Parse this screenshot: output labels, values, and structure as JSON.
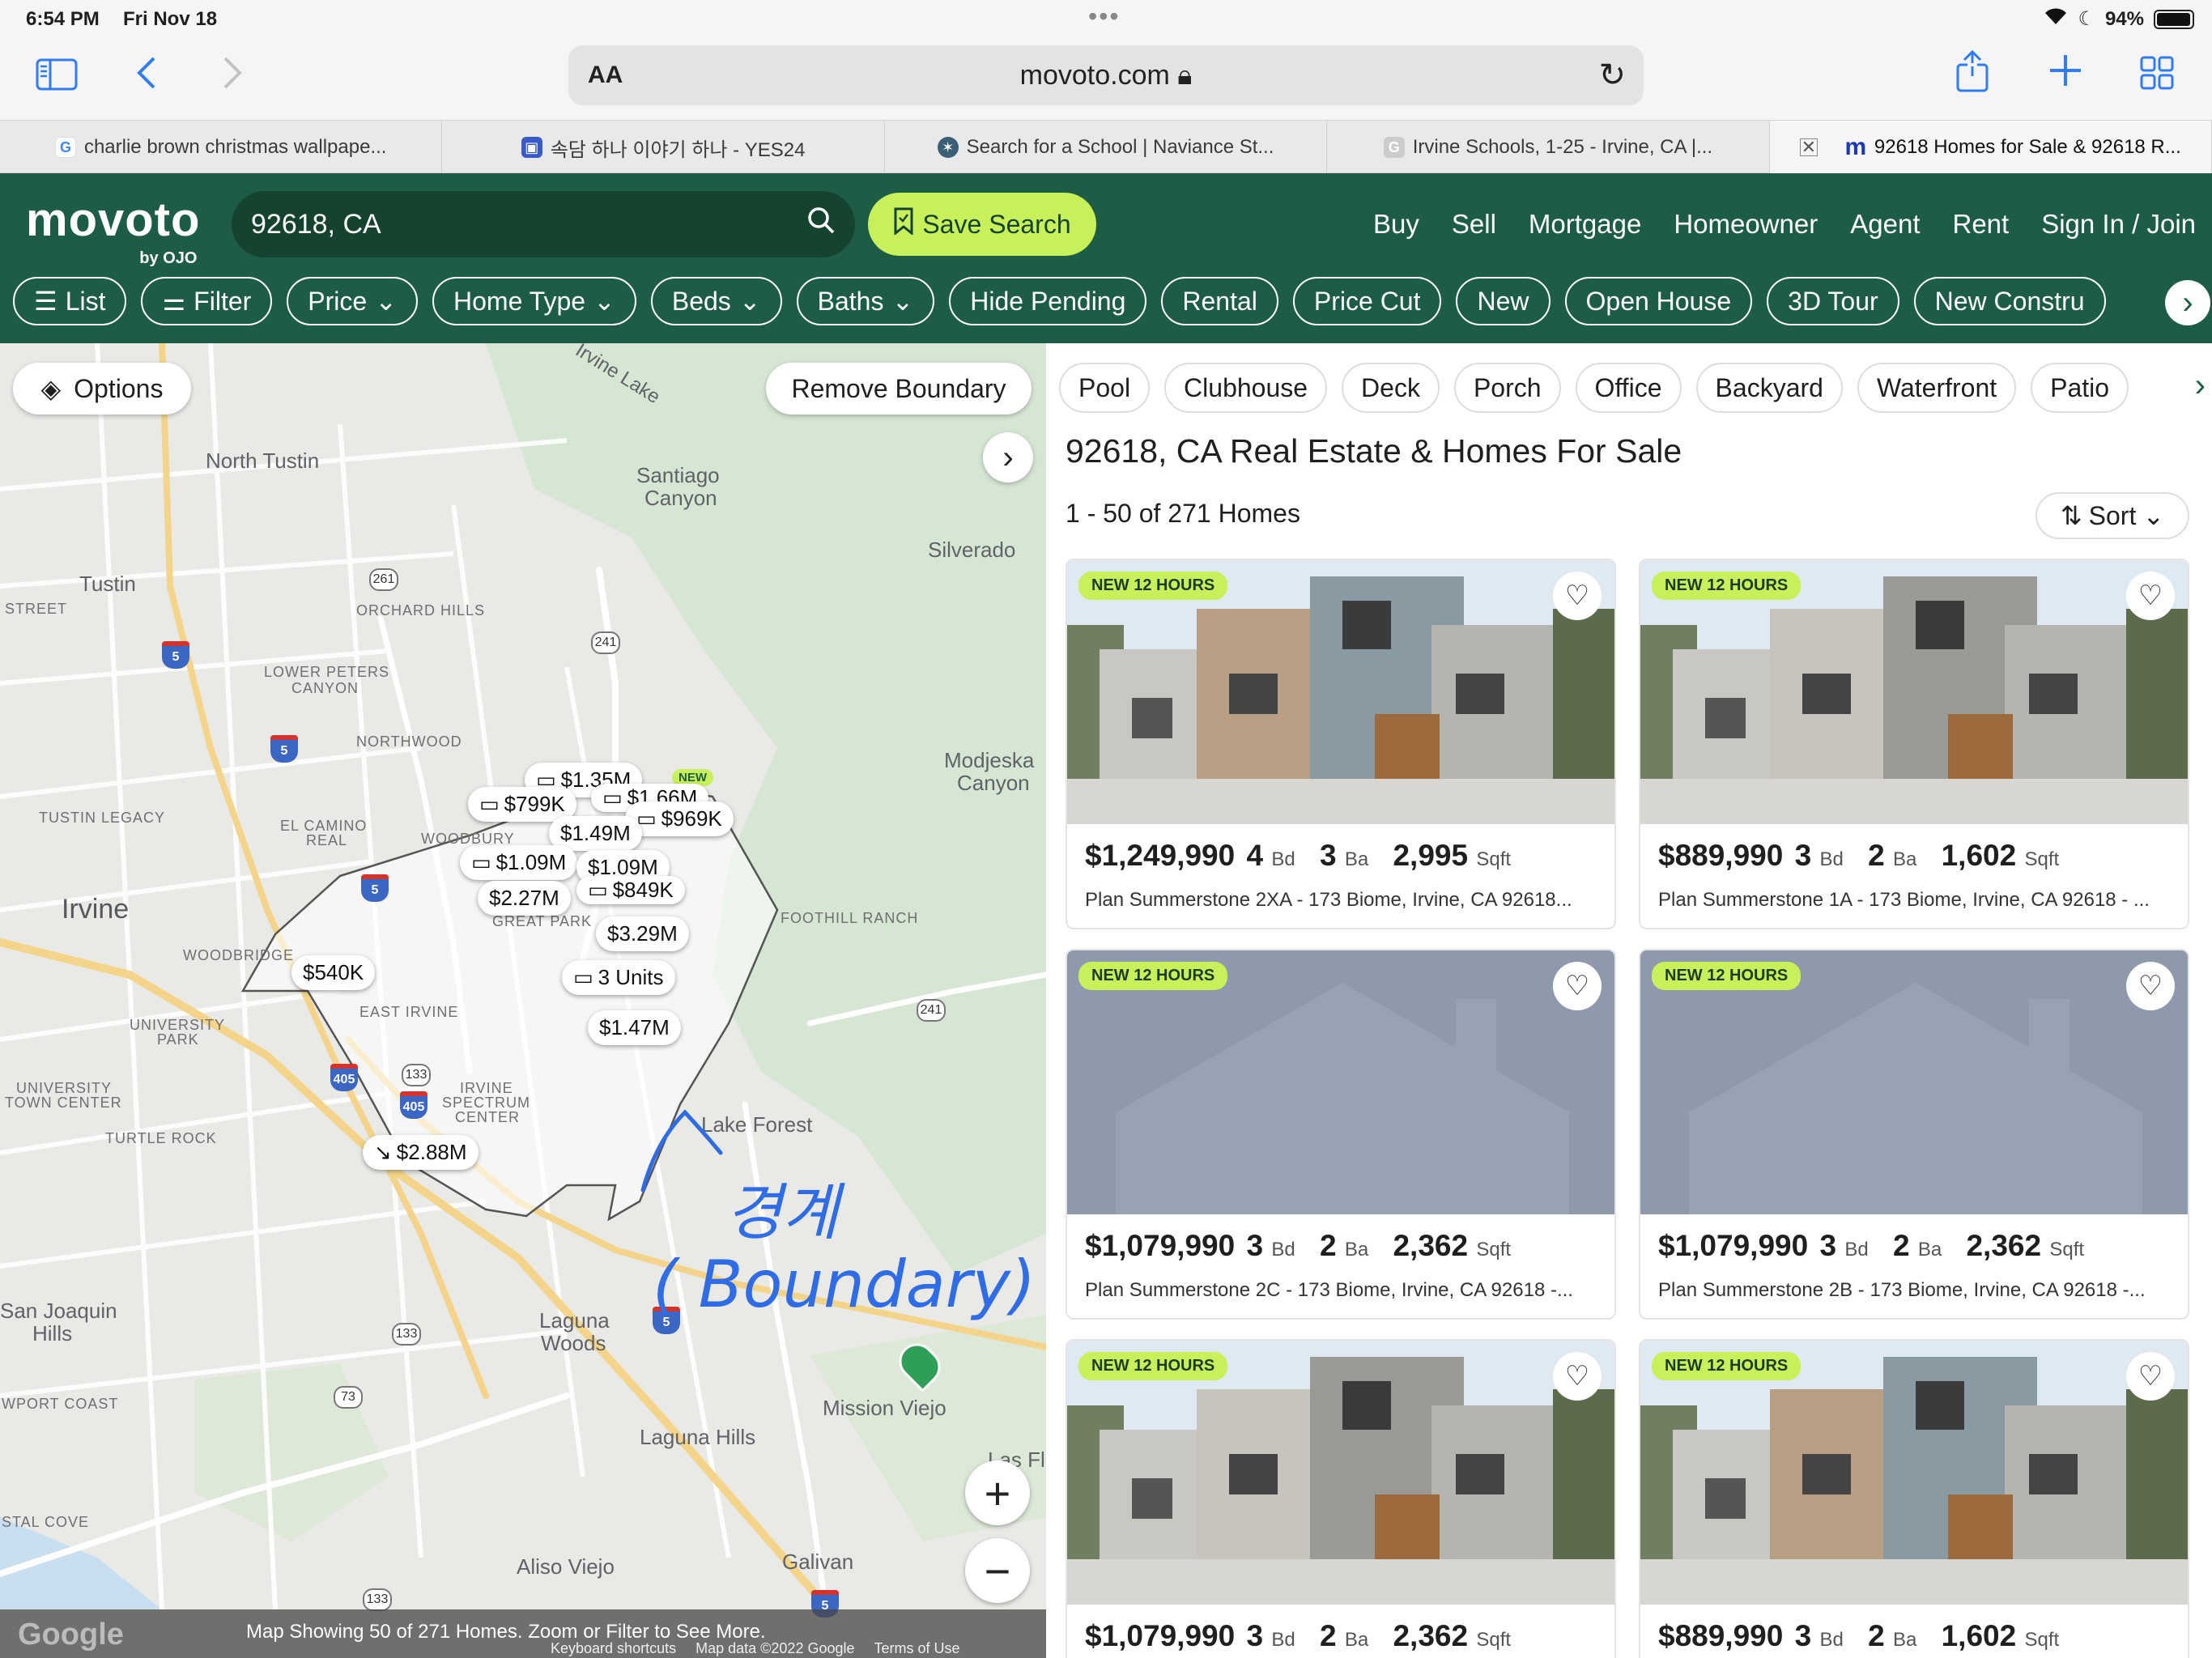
{
  "status": {
    "time": "6:54 PM",
    "date": "Fri Nov 18",
    "battery": "94%"
  },
  "browser": {
    "url": "movoto.com",
    "aa": "AA",
    "tabs": [
      {
        "title": "charlie brown christmas wallpape...",
        "icon": "google-icon"
      },
      {
        "title": "속담 하나 이야기 하나 - YES24",
        "icon": "yes24-icon"
      },
      {
        "title": "Search for a School | Naviance St...",
        "icon": "naviance-icon"
      },
      {
        "title": "Irvine Schools, 1-25 - Irvine, CA |...",
        "icon": "g-icon"
      },
      {
        "title": "92618 Homes for Sale & 92618 R...",
        "icon": "movoto-icon"
      }
    ]
  },
  "header": {
    "logo": "movoto",
    "logo_sub": "by OJO",
    "search_value": "92618, CA",
    "save_search": "Save Search",
    "nav": [
      "Buy",
      "Sell",
      "Mortgage",
      "Homeowner",
      "Agent",
      "Rent",
      "Sign In / Join"
    ],
    "filters": [
      "List",
      "Filter",
      "Price",
      "Home Type",
      "Beds",
      "Baths",
      "Hide Pending",
      "Rental",
      "Price Cut",
      "New",
      "Open House",
      "3D Tour",
      "New Constru"
    ]
  },
  "map": {
    "options": "Options",
    "remove_boundary": "Remove Boundary",
    "footer_message": "Map Showing 50 of 271 Homes. Zoom or Filter to See More.",
    "google": "Google",
    "credits": [
      "Keyboard shortcuts",
      "Map data ©2022 Google",
      "Terms of Use"
    ],
    "new_badge": "NEW",
    "labels": {
      "irvine_lake": "Irvine Lake",
      "north_tustin": "North Tustin",
      "santiago": "Santiago",
      "canyon": "Canyon",
      "silverado": "Silverado",
      "tustin": "Tustin",
      "street": "STREET",
      "orchard_hills": "ORCHARD HILLS",
      "lower_peters": "LOWER PETERS",
      "canyon_small": "CANYON",
      "northwood": "NORTHWOOD",
      "modjeska": "Modjeska",
      "modjeska_canyon": "Canyon",
      "tustin_legacy": "TUSTIN LEGACY",
      "el_camino": "EL CAMINO",
      "real": "REAL",
      "woodbury": "WOODBURY",
      "irvine": "Irvine",
      "great_park": "GREAT PARK",
      "foothill_ranch": "FOOTHILL RANCH",
      "woodbridge": "WOODBRIDGE",
      "east_irvine": "EAST IRVINE",
      "university": "UNIVERSITY",
      "park": "PARK",
      "irvine_spectrum": "IRVINE",
      "spectrum": "SPECTRUM",
      "center": "CENTER",
      "university_town": "UNIVERSITY",
      "town_center": "TOWN CENTER",
      "turtle_rock": "TURTLE ROCK",
      "lake_forest": "Lake Forest",
      "san_joaquin": "San Joaquin",
      "hills": "Hills",
      "laguna": "Laguna",
      "woods": "Woods",
      "newport_coast": "WPORT COAST",
      "mission_viejo": "Mission Viejo",
      "laguna_hills": "Laguna Hills",
      "las_flores": "Las Fl",
      "crystal_cove": "STAL COVE",
      "aliso_viejo": "Aliso Viejo",
      "galivan": "Galivan"
    },
    "shields": {
      "r261": "261",
      "r241": "241",
      "r241b": "241",
      "r133": "133",
      "r133b": "133",
      "r133c": "133",
      "r73": "73",
      "i5a": "5",
      "i5b": "5",
      "i5c": "5",
      "i5d": "5",
      "i5e": "5",
      "i405a": "405",
      "i405b": "405"
    },
    "pins": [
      {
        "label": "$1.35M"
      },
      {
        "label": "$799K"
      },
      {
        "label": "$1.66M"
      },
      {
        "label": "$969K"
      },
      {
        "label": "$1.49M"
      },
      {
        "label": "$1.09M"
      },
      {
        "label": "$1.09M"
      },
      {
        "label": "$849K"
      },
      {
        "label": "$2.27M"
      },
      {
        "label": "$3.29M"
      },
      {
        "label": "$540K"
      },
      {
        "label": "3 Units"
      },
      {
        "label": "$1.47M"
      },
      {
        "label": "$2.88M"
      }
    ],
    "annotation_korean": "경계",
    "annotation_english": "( Boundary)"
  },
  "listings": {
    "amenities": [
      "Pool",
      "Clubhouse",
      "Deck",
      "Porch",
      "Office",
      "Backyard",
      "Waterfront",
      "Patio"
    ],
    "title": "92618, CA Real Estate & Homes For Sale",
    "count": "1 - 50 of 271 Homes",
    "sort": "Sort",
    "units": {
      "bd": "Bd",
      "ba": "Ba",
      "sqft": "Sqft"
    },
    "cards": [
      {
        "badge": "NEW 12 HOURS",
        "price": "$1,249,990",
        "beds": "4",
        "baths": "3",
        "sqft": "2,995",
        "address": "Plan Summerstone 2XA - 173 Biome, Irvine, CA 92618..."
      },
      {
        "badge": "NEW 12 HOURS",
        "price": "$889,990",
        "beds": "3",
        "baths": "2",
        "sqft": "1,602",
        "address": "Plan Summerstone 1A - 173 Biome, Irvine, CA 92618 - ..."
      },
      {
        "badge": "NEW 12 HOURS",
        "price": "$1,079,990",
        "beds": "3",
        "baths": "2",
        "sqft": "2,362",
        "address": "Plan Summerstone 2C - 173 Biome, Irvine, CA 92618 -..."
      },
      {
        "badge": "NEW 12 HOURS",
        "price": "$1,079,990",
        "beds": "3",
        "baths": "2",
        "sqft": "2,362",
        "address": "Plan Summerstone 2B - 173 Biome, Irvine, CA 92618 -..."
      },
      {
        "badge": "NEW 12 HOURS",
        "price": "$1,079,990",
        "beds": "3",
        "baths": "2",
        "sqft": "2,362",
        "address": ""
      },
      {
        "badge": "NEW 12 HOURS",
        "price": "$889,990",
        "beds": "3",
        "baths": "2",
        "sqft": "1,602",
        "address": ""
      }
    ]
  },
  "colors": {
    "brand_green": "#1d5c45",
    "accent_lime": "#c8f05a",
    "ios_blue": "#2f7cf6"
  }
}
